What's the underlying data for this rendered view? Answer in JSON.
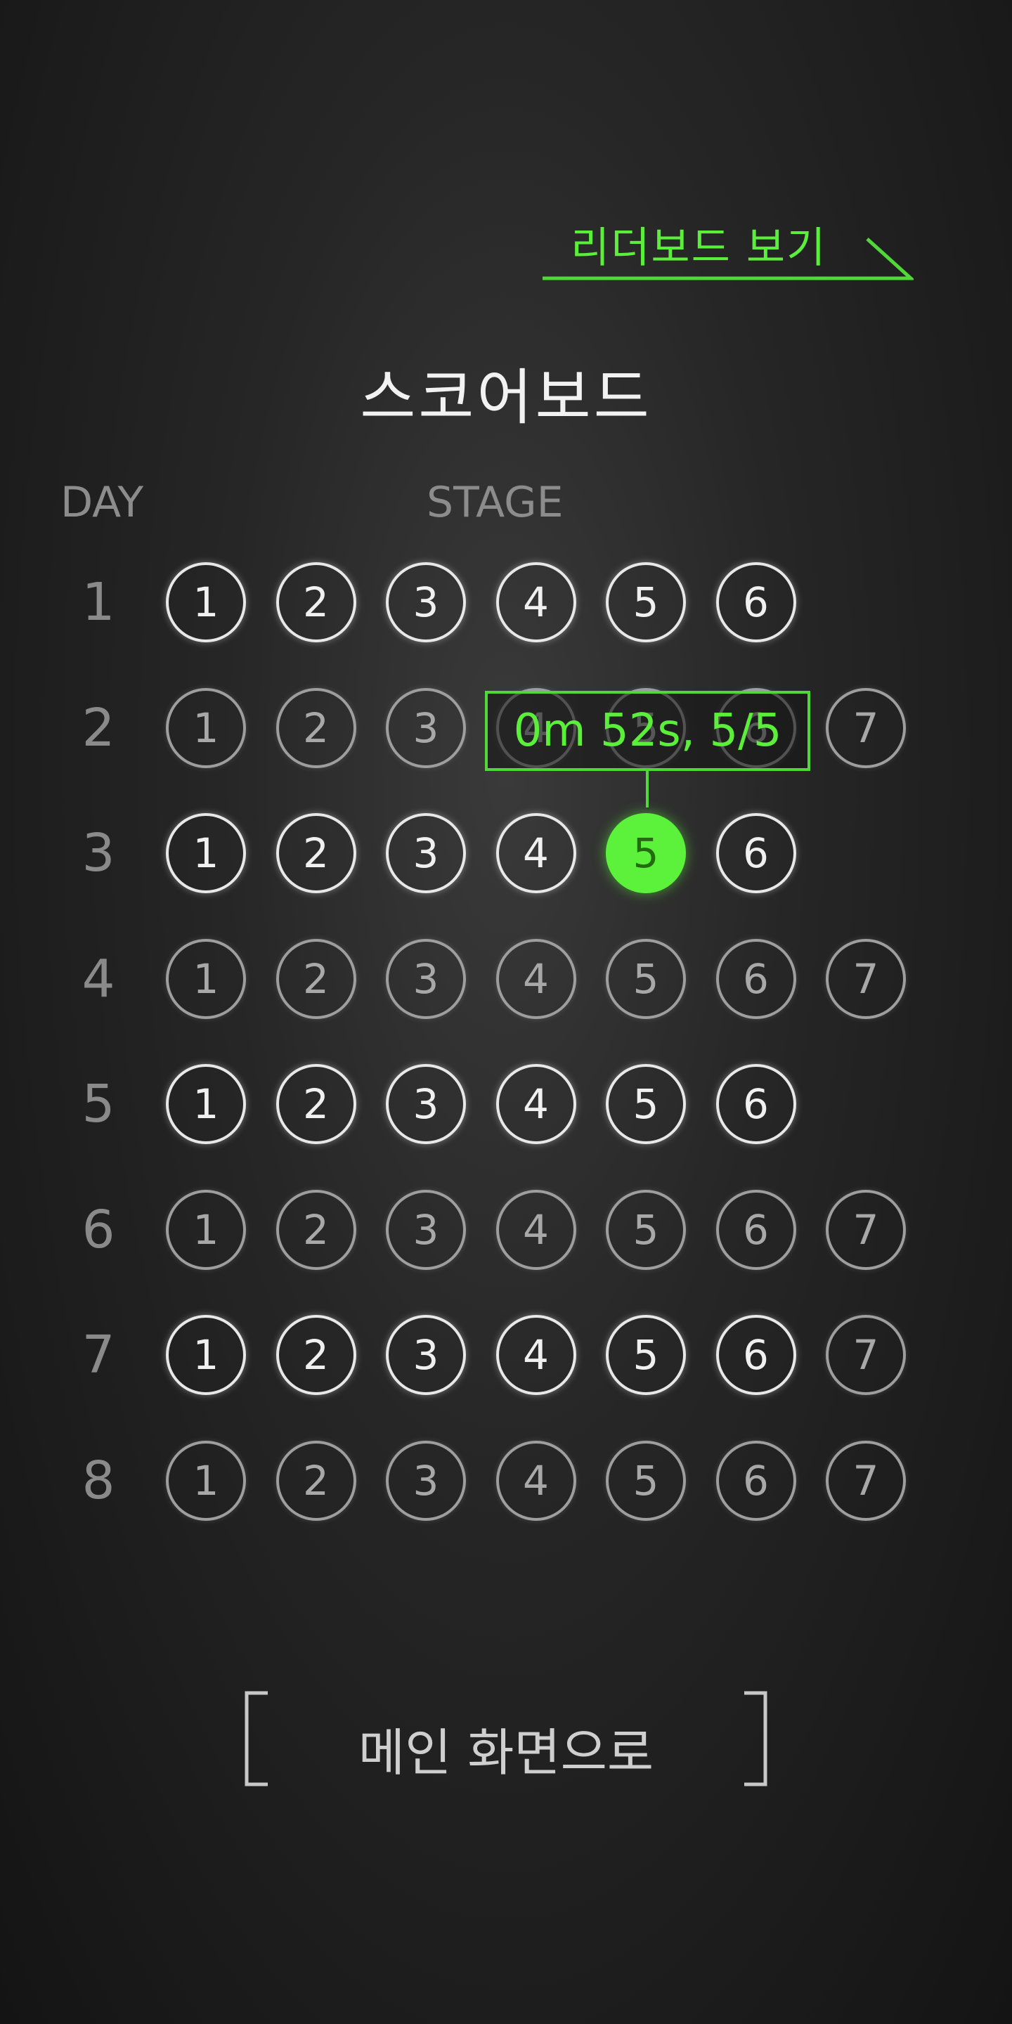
{
  "leaderboard_link": "리더보드 보기",
  "title": "스코어보드",
  "columns": {
    "day": "DAY",
    "stage": "STAGE"
  },
  "days": [
    {
      "label": "1",
      "stages": [
        "1",
        "2",
        "3",
        "4",
        "5",
        "6"
      ]
    },
    {
      "label": "2",
      "stages": [
        "1",
        "2",
        "3",
        "4",
        "5",
        "6",
        "7"
      ]
    },
    {
      "label": "3",
      "stages": [
        "1",
        "2",
        "3",
        "4",
        "5",
        "6"
      ]
    },
    {
      "label": "4",
      "stages": [
        "1",
        "2",
        "3",
        "4",
        "5",
        "6",
        "7"
      ]
    },
    {
      "label": "5",
      "stages": [
        "1",
        "2",
        "3",
        "4",
        "5",
        "6"
      ]
    },
    {
      "label": "6",
      "stages": [
        "1",
        "2",
        "3",
        "4",
        "5",
        "6",
        "7"
      ]
    },
    {
      "label": "7",
      "stages": [
        "1",
        "2",
        "3",
        "4",
        "5",
        "6",
        "7"
      ]
    },
    {
      "label": "8",
      "stages": [
        "1",
        "2",
        "3",
        "4",
        "5",
        "6",
        "7"
      ]
    }
  ],
  "selected": {
    "day": "3",
    "stage": "5"
  },
  "tooltip": "0m 52s, 5/5",
  "main_menu_button": "메인 화면으로",
  "colors": {
    "accent": "#5cf23c",
    "background": "#1e1e1e"
  }
}
